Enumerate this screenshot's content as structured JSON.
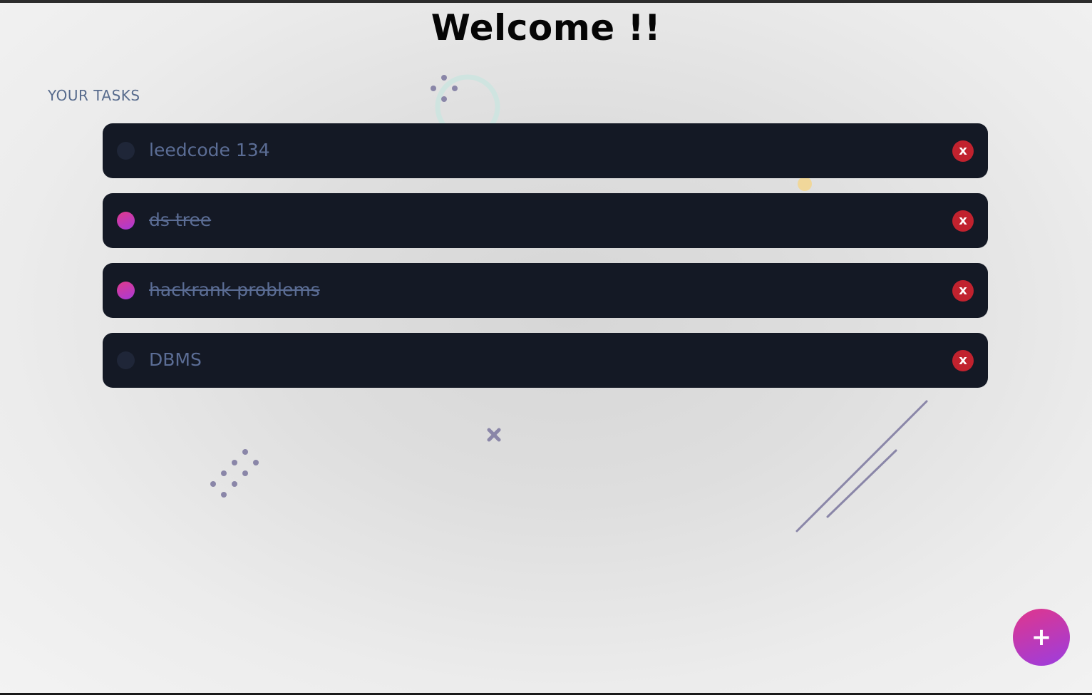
{
  "header": {
    "title": "Welcome !!"
  },
  "section": {
    "label": "YOUR TASKS"
  },
  "tasks": [
    {
      "text": "leedcode 134",
      "completed": false
    },
    {
      "text": "ds  tree",
      "completed": true
    },
    {
      "text": "hackrank problems",
      "completed": true
    },
    {
      "text": "DBMS",
      "completed": false
    }
  ],
  "delete_label": "x",
  "add_button": {
    "label": "+"
  },
  "colors": {
    "task_bg": "#141925",
    "task_text": "#5b6d95",
    "delete_bg": "#c1222e",
    "accent_start": "#e0368c",
    "accent_end": "#9b3ddf",
    "decoration": "#8a86a8"
  },
  "icons": {
    "delete": "close-icon",
    "add": "plus-icon",
    "check": "checkbox-circle-icon"
  }
}
